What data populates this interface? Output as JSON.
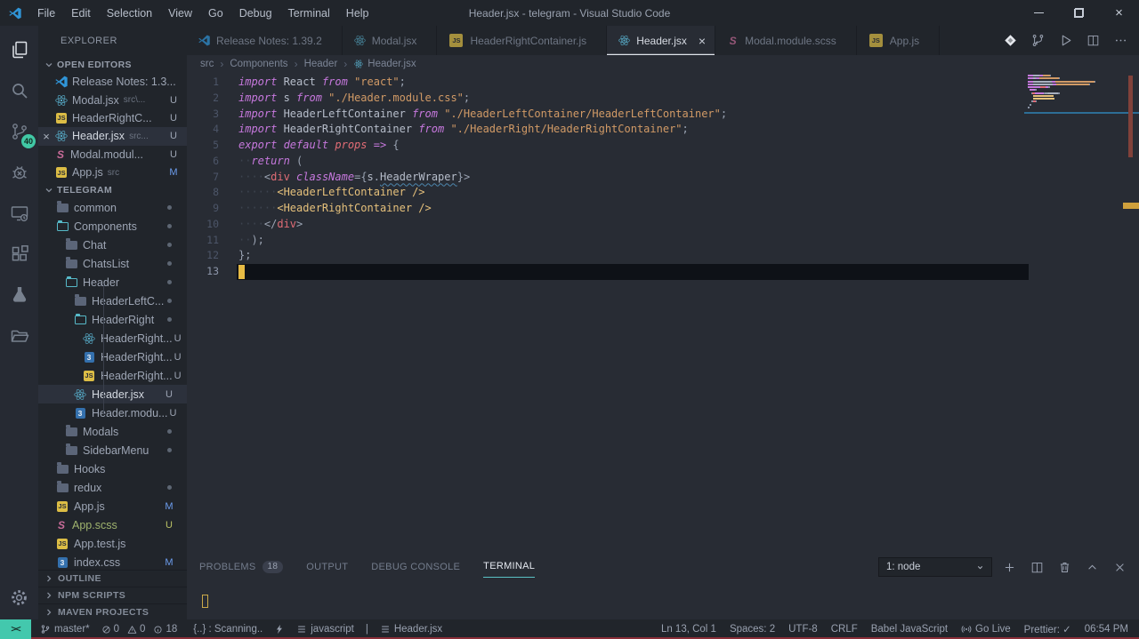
{
  "window": {
    "title": "Header.jsx - telegram - Visual Studio Code",
    "menus": [
      "File",
      "Edit",
      "Selection",
      "View",
      "Go",
      "Debug",
      "Terminal",
      "Help"
    ],
    "controls": [
      "minimize",
      "restore",
      "close"
    ]
  },
  "activity_bar": {
    "items": [
      {
        "name": "explorer",
        "icon": "files",
        "active": true
      },
      {
        "name": "search",
        "icon": "search"
      },
      {
        "name": "source-control",
        "icon": "source-control",
        "badge": "40"
      },
      {
        "name": "debug",
        "icon": "debug"
      },
      {
        "name": "remote-explorer",
        "icon": "monitor"
      },
      {
        "name": "extensions",
        "icon": "extensions"
      },
      {
        "name": "test-explorer",
        "icon": "flask"
      },
      {
        "name": "project-manager",
        "icon": "folder-opened"
      }
    ],
    "settings_icon": "gear"
  },
  "sidebar": {
    "title": "EXPLORER",
    "open_editors": {
      "header": "OPEN EDITORS",
      "items": [
        {
          "icon": "vscode",
          "label": "Release Notes: 1.3..."
        },
        {
          "icon": "react",
          "label": "Modal.jsx",
          "desc": "src\\...",
          "status": "U",
          "status_class": "u"
        },
        {
          "icon": "js",
          "label": "HeaderRightC...",
          "status": "U",
          "status_class": "u"
        },
        {
          "icon": "react",
          "label": "Header.jsx",
          "desc": "src...",
          "status": "U",
          "status_class": "u",
          "active": true
        },
        {
          "icon": "sass",
          "label": "Modal.modul...",
          "status": "U",
          "status_class": "u"
        },
        {
          "icon": "js",
          "label": "App.js",
          "desc": "src",
          "status": "M",
          "status_class": "m"
        }
      ]
    },
    "project": {
      "header": "TELEGRAM",
      "items": [
        {
          "label": "common",
          "icon": "folder",
          "level": 1,
          "badge": "dot"
        },
        {
          "label": "Components",
          "icon": "folder-open",
          "level": 1,
          "badge": "dot"
        },
        {
          "label": "Chat",
          "icon": "folder",
          "level": 2,
          "badge": "dot"
        },
        {
          "label": "ChatsList",
          "icon": "folder",
          "level": 2,
          "badge": "dot"
        },
        {
          "label": "Header",
          "icon": "folder-open",
          "level": 2,
          "badge": "dot"
        },
        {
          "label": "HeaderLeftC...",
          "icon": "folder",
          "level": 3,
          "badge": "dot"
        },
        {
          "label": "HeaderRight",
          "icon": "folder-open",
          "level": 3,
          "badge": "dot"
        },
        {
          "label": "HeaderRight...",
          "icon": "react",
          "level": 4,
          "badge": "U",
          "status_class": "u"
        },
        {
          "label": "HeaderRight...",
          "icon": "css",
          "level": 4,
          "badge": "U",
          "status_class": "u"
        },
        {
          "label": "HeaderRight...",
          "icon": "js",
          "level": 4,
          "badge": "U",
          "status_class": "u"
        },
        {
          "label": "Header.jsx",
          "icon": "react",
          "level": 3,
          "badge": "U",
          "status_class": "u",
          "selected": true
        },
        {
          "label": "Header.modu...",
          "icon": "css",
          "level": 3,
          "badge": "U",
          "status_class": "u"
        },
        {
          "label": "Modals",
          "icon": "folder",
          "level": 2,
          "badge": "dot"
        },
        {
          "label": "SidebarMenu",
          "icon": "folder",
          "level": 2,
          "badge": "dot"
        },
        {
          "label": "Hooks",
          "icon": "folder",
          "level": 1
        },
        {
          "label": "redux",
          "icon": "folder",
          "level": 1,
          "badge": "dot"
        },
        {
          "label": "App.js",
          "icon": "js",
          "level": 1,
          "badge": "M",
          "status_class": "m"
        },
        {
          "label": "App.scss",
          "icon": "sass",
          "level": 1,
          "badge": "U",
          "status_class": "ug",
          "label_class": "green"
        },
        {
          "label": "App.test.js",
          "icon": "js",
          "level": 1
        },
        {
          "label": "index.css",
          "icon": "css",
          "level": 1,
          "badge": "M",
          "status_class": "m"
        },
        {
          "label": "",
          "icon": "js",
          "level": 1,
          "badge": "dot"
        }
      ]
    },
    "sections": [
      "OUTLINE",
      "NPM SCRIPTS",
      "MAVEN PROJECTS"
    ]
  },
  "editor_tabs": {
    "items": [
      {
        "icon": "vscode",
        "label": "Release Notes: 1.39.2"
      },
      {
        "icon": "react",
        "label": "Modal.jsx"
      },
      {
        "icon": "js",
        "label": "HeaderRightContainer.js"
      },
      {
        "icon": "react",
        "label": "Header.jsx",
        "active": true
      },
      {
        "icon": "sass",
        "label": "Modal.module.scss"
      },
      {
        "icon": "js",
        "label": "App.js"
      }
    ],
    "actions": [
      {
        "name": "format-diamond",
        "icon": "diamond"
      },
      {
        "name": "open-changes",
        "icon": "compare"
      },
      {
        "name": "run",
        "icon": "run"
      },
      {
        "name": "split-editor",
        "icon": "split"
      },
      {
        "name": "more-actions",
        "icon": "more"
      }
    ]
  },
  "breadcrumbs": [
    {
      "label": "src"
    },
    {
      "label": "Components"
    },
    {
      "label": "Header"
    },
    {
      "label": "Header.jsx",
      "icon": "react"
    }
  ],
  "editor": {
    "lines": [
      {
        "n": 1,
        "t": [
          [
            "kw",
            "import"
          ],
          [
            "id",
            " React "
          ],
          [
            "kw",
            "from"
          ],
          [
            "str",
            " \"react\""
          ],
          [
            "pun",
            ";"
          ]
        ]
      },
      {
        "n": 2,
        "t": [
          [
            "kw",
            "import"
          ],
          [
            "id",
            " s "
          ],
          [
            "kw",
            "from"
          ],
          [
            "str",
            " \"./Header.module.css\""
          ],
          [
            "pun",
            ";"
          ]
        ]
      },
      {
        "n": 3,
        "t": [
          [
            "kw",
            "import"
          ],
          [
            "id",
            " HeaderLeftContainer "
          ],
          [
            "kw",
            "from"
          ],
          [
            "str",
            " \"./HeaderLeftContainer/HeaderLeftContainer\""
          ],
          [
            "pun",
            ";"
          ]
        ]
      },
      {
        "n": 4,
        "t": [
          [
            "kw",
            "import"
          ],
          [
            "id",
            " HeaderRightContainer "
          ],
          [
            "kw",
            "from"
          ],
          [
            "str",
            " \"./HeaderRight/HeaderRightContainer\""
          ],
          [
            "pun",
            ";"
          ]
        ]
      },
      {
        "n": 5,
        "t": [
          [
            "kw",
            "export"
          ],
          [
            "kw",
            " default"
          ],
          [
            "param",
            " props"
          ],
          [
            "kw",
            " =>"
          ],
          [
            "pun",
            " {"
          ]
        ]
      },
      {
        "n": 6,
        "t": [
          [
            "ws",
            "··"
          ],
          [
            "kw",
            "return"
          ],
          [
            "pun",
            " ("
          ]
        ]
      },
      {
        "n": 7,
        "t": [
          [
            "ws",
            "····"
          ],
          [
            "pun",
            "<"
          ],
          [
            "tag",
            "div"
          ],
          [
            "attr",
            " className"
          ],
          [
            "pun",
            "="
          ],
          [
            "pun",
            "{"
          ],
          [
            "id",
            "s"
          ],
          [
            "pun",
            "."
          ],
          [
            "spell",
            "HeaderWraper"
          ],
          [
            "pun",
            "}"
          ],
          [
            "pun",
            ">"
          ]
        ]
      },
      {
        "n": 8,
        "t": [
          [
            "ws",
            "······"
          ],
          [
            "comp",
            "<HeaderLeftContainer />"
          ]
        ]
      },
      {
        "n": 9,
        "t": [
          [
            "ws",
            "······"
          ],
          [
            "comp",
            "<HeaderRightContainer />"
          ]
        ]
      },
      {
        "n": 10,
        "t": [
          [
            "ws",
            "····"
          ],
          [
            "pun",
            "</"
          ],
          [
            "tag",
            "div"
          ],
          [
            "pun",
            ">"
          ]
        ]
      },
      {
        "n": 11,
        "t": [
          [
            "ws",
            "··"
          ],
          [
            "pun",
            ");"
          ]
        ]
      },
      {
        "n": 12,
        "t": [
          [
            "pun",
            "};"
          ]
        ]
      },
      {
        "n": 13,
        "t": [],
        "current": true
      }
    ],
    "cursor_line": 13
  },
  "panel": {
    "tabs": [
      {
        "label": "PROBLEMS",
        "badge": "18"
      },
      {
        "label": "OUTPUT"
      },
      {
        "label": "DEBUG CONSOLE"
      },
      {
        "label": "TERMINAL",
        "active": true
      }
    ],
    "terminal_select": "1: node",
    "actions": [
      {
        "name": "new-terminal",
        "icon": "plus"
      },
      {
        "name": "split-terminal",
        "icon": "split"
      },
      {
        "name": "kill-terminal",
        "icon": "trash"
      },
      {
        "name": "maximize-panel",
        "icon": "chevron-up"
      },
      {
        "name": "close-panel",
        "icon": "close"
      }
    ]
  },
  "status_bar": {
    "remote_label": "><",
    "left": [
      {
        "name": "git-branch",
        "icon": "branch",
        "label": "master*"
      },
      {
        "name": "problems-summary",
        "group": [
          [
            "error",
            "0"
          ],
          [
            "warning",
            "0"
          ],
          [
            "info",
            "18"
          ]
        ]
      },
      {
        "name": "scanning",
        "label": "{..} : Scanning.."
      },
      {
        "name": "lightning",
        "icon": "lightning",
        "label": ""
      },
      {
        "name": "language-javascript",
        "icon": "list",
        "label": "javascript"
      },
      {
        "name": "separator",
        "label": "|"
      },
      {
        "name": "outline-header",
        "icon": "list",
        "label": "Header.jsx"
      }
    ],
    "right": [
      {
        "name": "cursor-position",
        "label": "Ln 13, Col 1"
      },
      {
        "name": "indentation",
        "label": "Spaces: 2"
      },
      {
        "name": "encoding",
        "label": "UTF-8"
      },
      {
        "name": "eol",
        "label": "CRLF"
      },
      {
        "name": "language-mode",
        "label": "Babel JavaScript"
      },
      {
        "name": "go-live",
        "icon": "broadcast",
        "label": "Go Live"
      },
      {
        "name": "prettier",
        "label": "Prettier: ✓"
      },
      {
        "name": "clock",
        "label": "06:54 PM"
      }
    ]
  },
  "colors": {
    "editor_bg": "#282c34",
    "chrome_bg": "#21252b",
    "accent_teal": "#43c8ad",
    "badge_green": "#41c8a5",
    "cursor_yellow": "#e7bb44",
    "keyword": "#c678dd",
    "string": "#d19a66",
    "tag": "#e06c75",
    "component": "#e5c07b",
    "modified_blue": "#6c9ded",
    "bottom_line_red": "#8a2e38"
  }
}
